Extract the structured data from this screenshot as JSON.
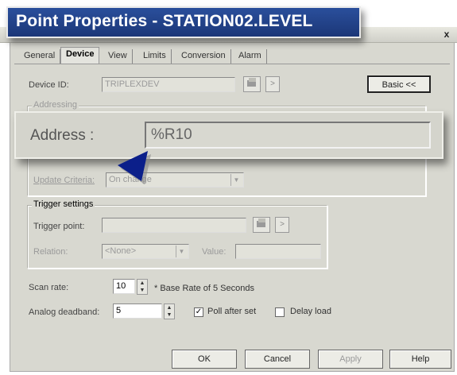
{
  "window": {
    "title": "Point Properties - STATION02.LEVEL",
    "close_glyph": "x"
  },
  "tabs": [
    "General",
    "Device",
    "View",
    "Limits",
    "Conversion",
    "Alarm"
  ],
  "active_tab": "Device",
  "device": {
    "label": "Device ID:",
    "value": "TRIPLEXDEV",
    "basic_button": "Basic <<"
  },
  "addressing": {
    "group_title": "Addressing",
    "address_label": "Address :",
    "address_value": "%R10",
    "update_criteria_label": "Update Criteria:",
    "update_criteria_value": "On change"
  },
  "trigger": {
    "group_title": "Trigger settings",
    "trigger_point_label": "Trigger point:",
    "relation_label": "Relation:",
    "relation_value": "<None>",
    "value_label": "Value:"
  },
  "scan": {
    "label": "Scan rate:",
    "value": "10",
    "note": "* Base Rate of 5 Seconds"
  },
  "deadband": {
    "label": "Analog deadband:",
    "value": "5"
  },
  "options": {
    "poll_after_set_label": "Poll after set",
    "poll_after_set_checked": true,
    "delay_load_label": "Delay load",
    "delay_load_checked": false
  },
  "buttons": {
    "ok": "OK",
    "cancel": "Cancel",
    "apply": "Apply",
    "help": "Help"
  },
  "icons": {
    "browse": "browse-icon",
    "arrow": "arrow-right-icon",
    "pointer": "pointer-arrow-icon"
  },
  "colors": {
    "title_bar": "#1c3778",
    "dialog_bg": "#d8d8d0",
    "pointer": "#0b1f8a"
  }
}
